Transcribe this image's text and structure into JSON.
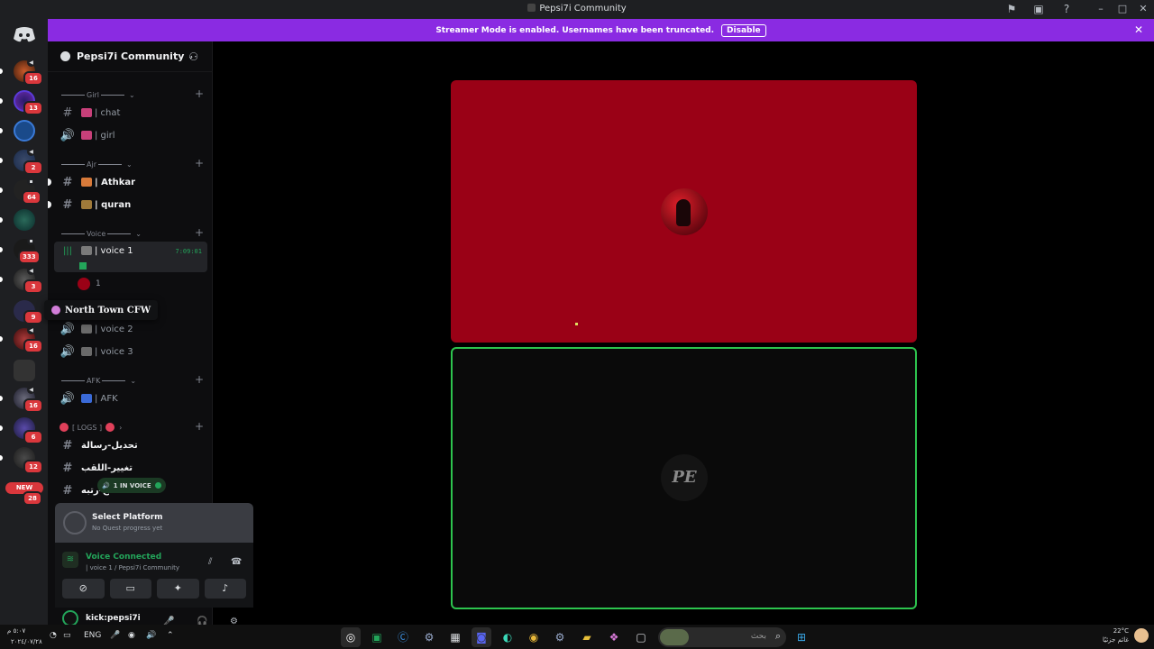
{
  "window": {
    "title": "Pepsi7i Community"
  },
  "banner": {
    "text": "Streamer Mode is enabled. Usernames have been truncated.",
    "disable_label": "Disable"
  },
  "rail": {
    "servers": [
      {
        "badge": "16"
      },
      {
        "badge": "13"
      },
      {
        "badge": ""
      },
      {
        "badge": "2"
      },
      {
        "badge": "64"
      },
      {
        "badge": ""
      },
      {
        "badge": "333"
      },
      {
        "badge": "3"
      },
      {
        "badge": "9"
      },
      {
        "badge": "16"
      },
      {
        "badge": ""
      },
      {
        "badge": "16"
      },
      {
        "badge": "6"
      },
      {
        "badge": "12"
      }
    ],
    "new_label": "NEW",
    "new_count": "28",
    "tooltip": "North Town CFW"
  },
  "guild": {
    "name": "Pepsi7i Community"
  },
  "categories": {
    "girl": "Girl",
    "ajr": "Ajr",
    "voice": "Voice",
    "afk": "AFK",
    "logs": "[ LOGS ]"
  },
  "channels": {
    "chat": "| chat",
    "girl": "| girl",
    "athkar": "| Athkar",
    "quran": "| quran",
    "voice1": "| voice 1",
    "voice1_timer": "7:09:01",
    "voice1_user": "1",
    "voice2": "| voice 2",
    "voice3": "| voice 3",
    "afk": "| AFK",
    "log1": "تحديل-رسالة",
    "log2": "تغيير-اللقب",
    "log3": "ح-رتبه"
  },
  "in_voice": "1 IN VOICE",
  "quest": {
    "title": "Select Platform",
    "subtitle": "No Quest progress yet"
  },
  "voice_panel": {
    "title": "Voice Connected",
    "subtitle": "| voice 1 / Pepsi7i Community"
  },
  "user": {
    "name": "kick:pepsi7i"
  },
  "tiles": {
    "bottom_initials": "PE"
  },
  "taskbar": {
    "time": "٥:٠٧ م",
    "date": "٢٠٢٤/٠٧/٢٨",
    "lang": "ENG",
    "search_placeholder": "بحث",
    "temperature": "22°C",
    "weather_text": "غائم جزئيًا"
  },
  "colors": {
    "banner": "#8a2be2",
    "tile_top": "#9a0116",
    "tile_border": "#2dc44e",
    "voice_green": "#23a55a"
  }
}
